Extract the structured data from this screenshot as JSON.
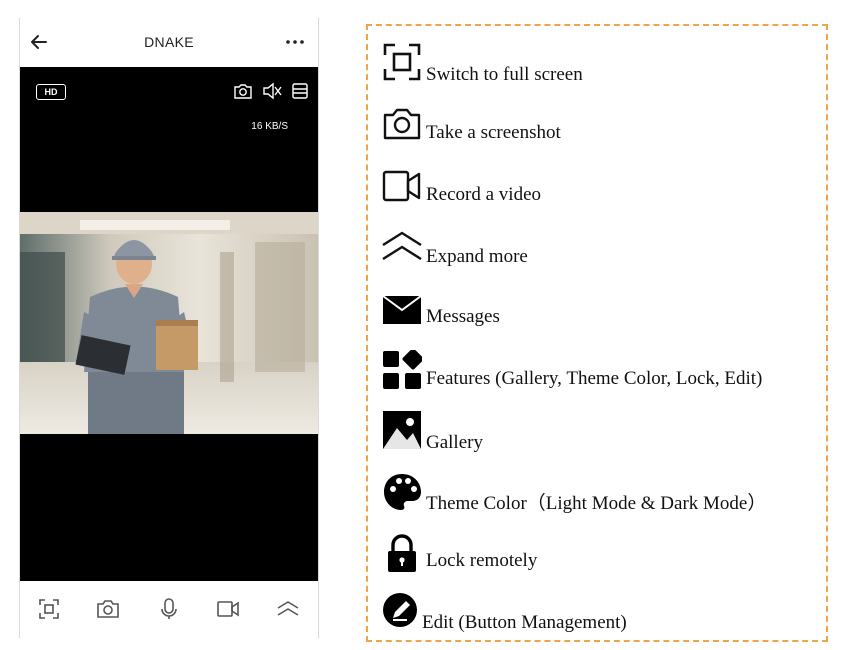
{
  "app": {
    "title": "DNAKE",
    "video": {
      "quality_badge": "HD",
      "data_rate": "16 KB/S"
    }
  },
  "bottom_controls": [
    {
      "icon": "fullscreen-icon"
    },
    {
      "icon": "camera-icon"
    },
    {
      "icon": "microphone-icon"
    },
    {
      "icon": "video-record-icon"
    },
    {
      "icon": "expand-more-icon"
    }
  ],
  "legend": [
    {
      "icon": "fullscreen-icon",
      "label": "Switch to full screen"
    },
    {
      "icon": "camera-icon",
      "label": "Take a screenshot"
    },
    {
      "icon": "video-record-icon",
      "label": "Record a video"
    },
    {
      "icon": "expand-more-icon",
      "label": "Expand more"
    },
    {
      "icon": "envelope-icon",
      "label": "Messages"
    },
    {
      "icon": "features-grid-icon",
      "label": "Features (Gallery, Theme Color, Lock, Edit)"
    },
    {
      "icon": "gallery-icon",
      "label": "Gallery"
    },
    {
      "icon": "palette-icon",
      "label": "Theme Color（Light Mode & Dark Mode）"
    },
    {
      "icon": "lock-icon",
      "label": "Lock remotely"
    },
    {
      "icon": "edit-icon",
      "label": "Edit (Button Management)"
    }
  ],
  "colors": {
    "legend_border": "#f0a44a",
    "video_bg": "#000000"
  }
}
